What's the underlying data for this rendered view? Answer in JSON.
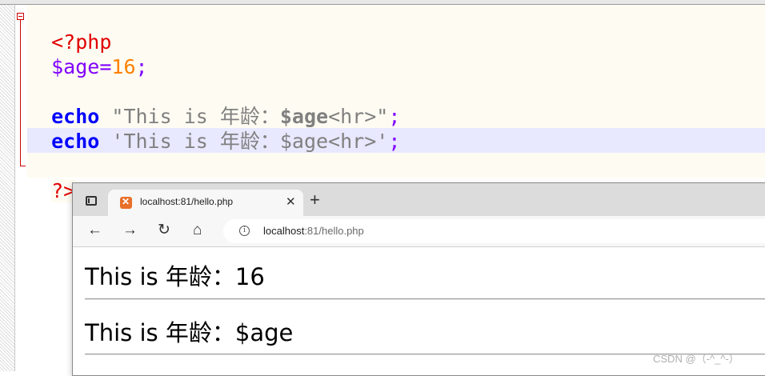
{
  "editor": {
    "lines": {
      "open_tag": "<?php",
      "var_name": "$age",
      "assign_op": "=",
      "number": "16",
      "semicolon": ";",
      "echo_keyword": "echo",
      "double_quote_open": "\"This is 年龄：",
      "double_quote_var": "$age",
      "double_quote_close": "<hr>\"",
      "single_quote": "'This is 年龄：$age<hr>'",
      "close_tag": "?>"
    }
  },
  "browser": {
    "tab_title": "localhost:81/hello.php",
    "tab_close": "✕",
    "new_tab": "+",
    "back": "←",
    "forward": "→",
    "reload": "↻",
    "home": "⌂",
    "info": "i",
    "url_host": "localhost",
    "url_rest": ":81/hello.php",
    "output_line_1": "This is 年龄：16",
    "output_line_2": "This is 年龄：$age"
  },
  "watermark": "CSDN @（-^_^-）"
}
